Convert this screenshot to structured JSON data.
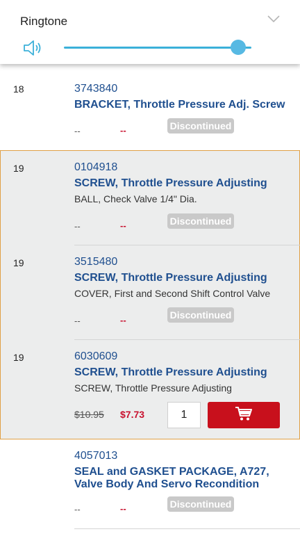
{
  "volume": {
    "title": "Ringtone",
    "level": 0.93
  },
  "parts": [
    {
      "seq": "18",
      "part_no": "3743840",
      "title": "BRACKET, Throttle Pressure Adj. Screw",
      "desc": "",
      "list_price": "--",
      "sale_price": "--",
      "status": "Discontinued"
    },
    {
      "seq": "19",
      "part_no": "0104918",
      "title": "SCREW, Throttle Pressure Adjusting",
      "desc": "BALL, Check Valve 1/4\" Dia.",
      "list_price": "--",
      "sale_price": "--",
      "status": "Discontinued"
    },
    {
      "seq": "19",
      "part_no": "3515480",
      "title": "SCREW, Throttle Pressure Adjusting",
      "desc": "COVER, First and Second Shift Control Valve",
      "list_price": "--",
      "sale_price": "--",
      "status": "Discontinued"
    },
    {
      "seq": "19",
      "part_no": "6030609",
      "title": "SCREW, Throttle Pressure Adjusting",
      "desc": "SCREW, Throttle Pressure Adjusting",
      "list_price": "$10.95",
      "sale_price": "$7.73",
      "quantity": "1"
    },
    {
      "seq": "",
      "part_no": "4057013",
      "title": "SEAL and GASKET PACKAGE, A727, Valve Body And Servo Recondition",
      "desc": "",
      "list_price": "--",
      "sale_price": "--",
      "status": "Discontinued"
    }
  ],
  "colors": {
    "accent": "#1f4f8f",
    "sale": "#c8102e",
    "highlight_border": "#e0a046",
    "cart": "#c8101c"
  }
}
